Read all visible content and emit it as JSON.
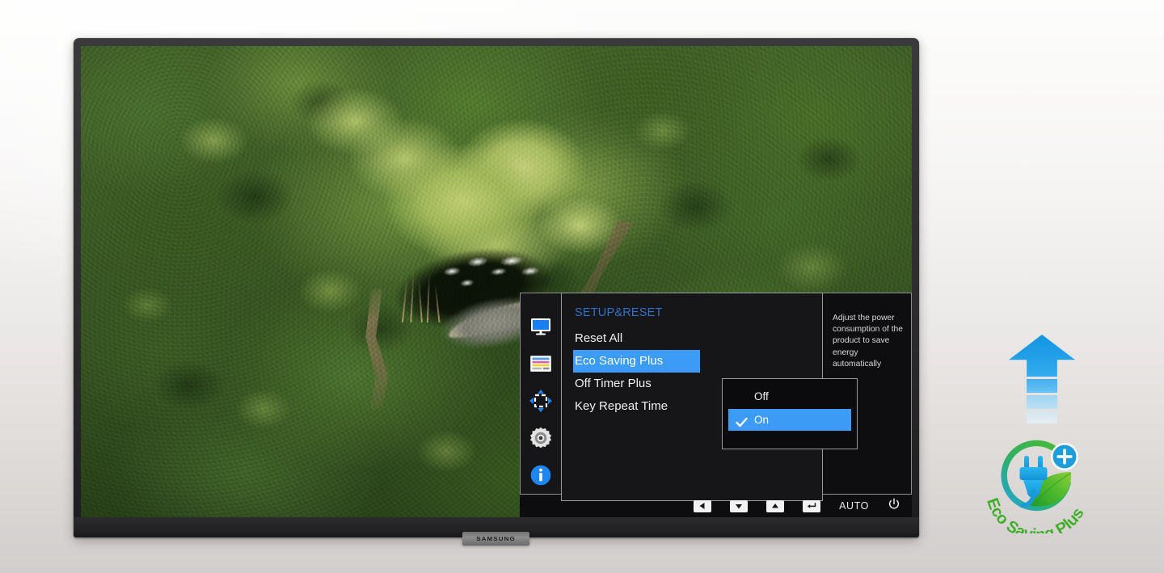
{
  "scene": {
    "title": "Samsung monitor displaying forest wallpaper with on-screen display menu",
    "background_top_color": "#fdfdfc",
    "background_bottom_color": "#d2cecd"
  },
  "monitor": {
    "brand_label": "SAMSUNG",
    "bezel_color": "#303032",
    "wallpaper_description": "Aerial photograph of dense green rainforest canopy with a dark pond and sandy shoreline"
  },
  "osd": {
    "title": "SETUP&RESET",
    "title_color": "#2f72c9",
    "highlight_color": "#3b9bf5",
    "background_color": "#161618",
    "border_color": "#9a9a9c",
    "category_icons": [
      {
        "name": "picture-icon",
        "label": "Picture"
      },
      {
        "name": "onscreen-display-icon",
        "label": "OnScreen Display"
      },
      {
        "name": "pip-pbp-icon",
        "label": "PIP/PBP"
      },
      {
        "name": "setup-reset-icon",
        "label": "Setup and Reset"
      },
      {
        "name": "information-icon",
        "label": "Information"
      }
    ],
    "menu_items": [
      {
        "label": "Reset All",
        "selected": false
      },
      {
        "label": "Eco Saving Plus",
        "selected": true
      },
      {
        "label": "Off Timer Plus",
        "selected": false
      },
      {
        "label": "Key Repeat Time",
        "selected": false
      }
    ],
    "dropdown": {
      "options": [
        {
          "label": "Off",
          "selected": false,
          "checked": false
        },
        {
          "label": "On",
          "selected": true,
          "checked": true
        }
      ]
    },
    "description": "Adjust the power consumption of the product to save energy automatically",
    "buttons": [
      {
        "name": "back-button",
        "icon": "left-triangle-icon",
        "label": ""
      },
      {
        "name": "down-button",
        "icon": "down-triangle-icon",
        "label": ""
      },
      {
        "name": "up-button",
        "icon": "up-triangle-icon",
        "label": ""
      },
      {
        "name": "enter-button",
        "icon": "enter-arrow-icon",
        "label": ""
      },
      {
        "name": "auto-button",
        "icon": "",
        "label": "AUTO"
      },
      {
        "name": "power-button",
        "icon": "power-icon",
        "label": ""
      }
    ]
  },
  "graphics": {
    "arrow": {
      "name": "upward-arrow-graphic",
      "color": "#22a0e8",
      "description": "Blue upward arrow with fading trailing segments"
    },
    "eco_logo": {
      "name": "eco-saving-plus-logo",
      "text": "Eco Saving Plus",
      "text_curved": true,
      "green_color": "#3fae2a",
      "blue_color": "#21a0dd",
      "plus_badge": "+",
      "elements": [
        "circular-arc",
        "power-plug",
        "leaf",
        "plus-badge",
        "curved-text"
      ]
    }
  }
}
